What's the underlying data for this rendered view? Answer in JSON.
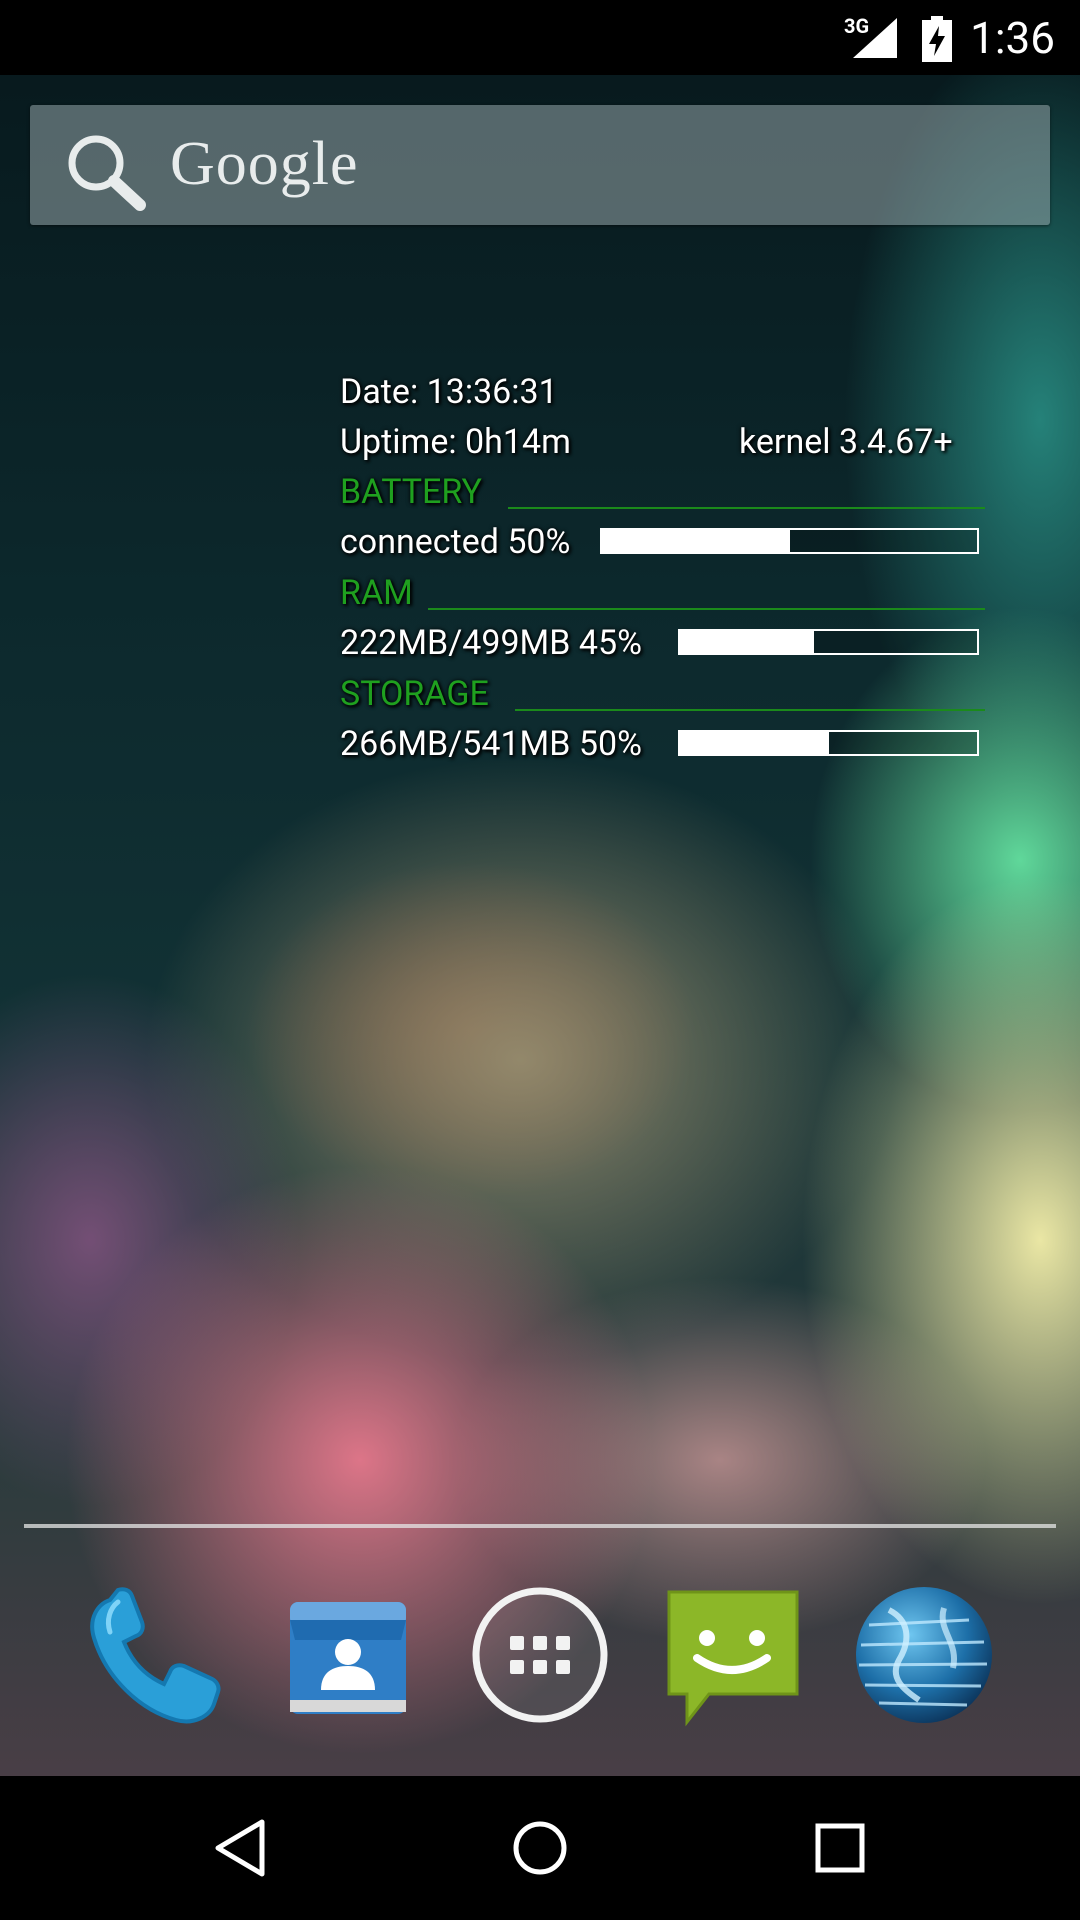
{
  "status_bar": {
    "network": "3G",
    "time": "1:36"
  },
  "search": {
    "logo_text": "Google"
  },
  "widget": {
    "date": "Date: 13:36:31",
    "uptime": "Uptime: 0h14m",
    "kernel": "kernel 3.4.67+",
    "battery": {
      "title": "BATTERY",
      "text": "connected 50%",
      "percent": 50
    },
    "ram": {
      "title": "RAM",
      "text": "222MB/499MB 45%",
      "percent": 45
    },
    "storage": {
      "title": "STORAGE",
      "text": "266MB/541MB 50%",
      "percent": 50
    },
    "accent_color": "#1fa01f"
  },
  "dock": {
    "apps": [
      "phone-icon",
      "contacts-icon",
      "app-drawer-icon",
      "messaging-icon",
      "browser-icon"
    ]
  },
  "nav": {
    "buttons": [
      "back-icon",
      "home-icon",
      "recents-icon"
    ]
  }
}
